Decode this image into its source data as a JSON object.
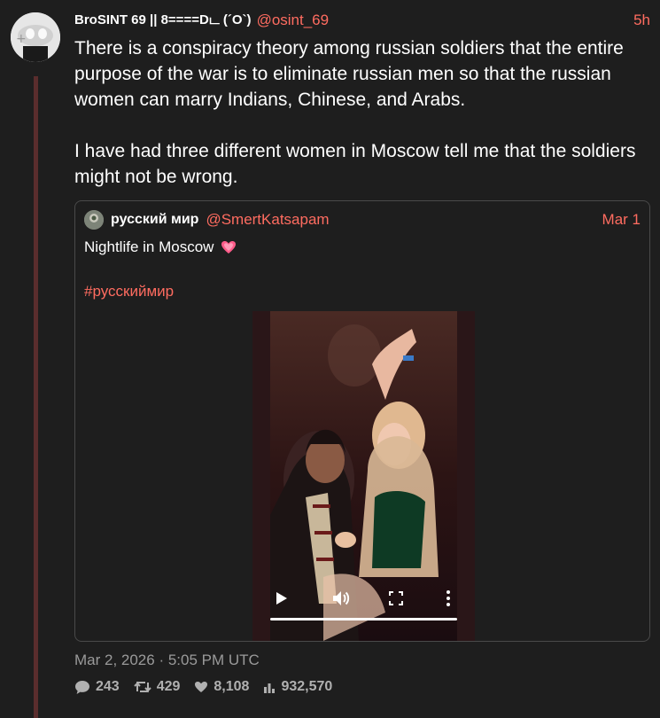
{
  "tweet": {
    "author": "BroSINT 69 || 8====Dட (´O`)",
    "handle": "@osint_69",
    "time": "5h",
    "paragraphs": [
      "There is a conspiracy theory among russian soldiers that the entire purpose of the war is to eliminate russian men so that the russian women can marry Indians, Chinese, and Arabs.",
      "I have had three different women in Moscow tell me that the soldiers might not be wrong."
    ],
    "date": "Mar 2, 2026 · 5:05 PM UTC",
    "stats": {
      "replies": "243",
      "retweets": "429",
      "likes": "8,108",
      "views": "932,570"
    }
  },
  "quote": {
    "author": "русский мир",
    "handle": "@SmertKatsapam",
    "date": "Mar 1",
    "text": "Nightlife in Moscow",
    "hashtag": "#русскиймир",
    "video": {
      "progress": 1.0
    }
  },
  "colors": {
    "background": "#1e1e1e",
    "accent": "#ff6c60",
    "thread_line": "#5a2d2d",
    "muted": "#9a9a9a"
  }
}
